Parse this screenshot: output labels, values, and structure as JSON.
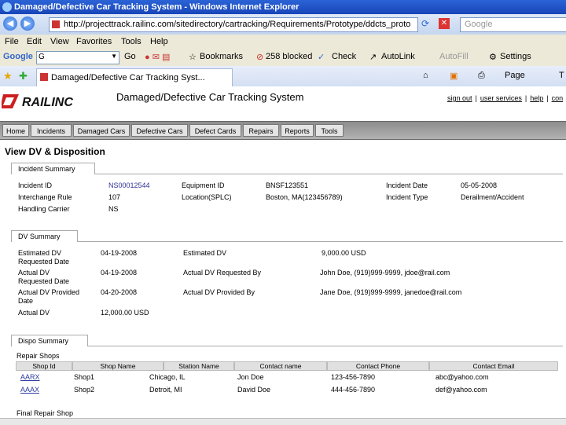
{
  "browser": {
    "window_title": "Damaged/Defective Car Tracking System - Windows Internet Explorer",
    "url": "http://projecttrack.railinc.com/sitedirectory/cartracking/Requirements/Prototype/ddcts_proto",
    "search_placeholder": "Google",
    "menu": [
      "File",
      "Edit",
      "View",
      "Favorites",
      "Tools",
      "Help"
    ],
    "google_toolbar": {
      "logo": "Google",
      "search_value": "G",
      "go_label": "Go",
      "bookmarks": "Bookmarks",
      "blocked": "258 blocked",
      "check": "Check",
      "autolink": "AutoLink",
      "autofill": "AutoFill",
      "settings": "Settings"
    },
    "tab_title": "Damaged/Defective Car Tracking Syst...",
    "page_menu": "Page",
    "tools_short": "T"
  },
  "app": {
    "logo_text": "RAILINC",
    "title": "Damaged/Defective Car Tracking System",
    "top_links": [
      "sign out",
      "user services",
      "help",
      "con"
    ],
    "nav": [
      "Home",
      "Incidents",
      "Damaged Cars",
      "Defective Cars",
      "Defect Cards",
      "Repairs",
      "Reports",
      "Tools"
    ]
  },
  "page": {
    "title": "View DV & Disposition",
    "incident_summary": {
      "tab_label": "Incident Summary",
      "incident_id_label": "Incident ID",
      "incident_id": "NS00012544",
      "equipment_id_label": "Equipment ID",
      "equipment_id": "BNSF123551",
      "incident_date_label": "Incident Date",
      "incident_date": "05-05-2008",
      "interchange_rule_label": "Interchange Rule",
      "interchange_rule": "107",
      "location_label": "Location(SPLC)",
      "location": "Boston, MA(123456789)",
      "incident_type_label": "Incident Type",
      "incident_type": "Derailment/Accident",
      "handling_carrier_label": "Handling Carrier",
      "handling_carrier": "NS"
    },
    "dv_summary": {
      "tab_label": "DV Summary",
      "est_dv_req_date_label_1": "Estimated DV",
      "est_dv_req_date_label_2": "Requested Date",
      "est_dv_req_date": "04-19-2008",
      "estimated_dv_label": "Estimated DV",
      "estimated_dv": "9,000.00 USD",
      "actual_dv_req_date_label_1": "Actual DV",
      "actual_dv_req_date_label_2": "Requested Date",
      "actual_dv_req_date": "04-19-2008",
      "actual_dv_requested_by_label": "Actual DV Requested By",
      "actual_dv_requested_by": "John Doe, (919)999-9999, jdoe@rail.com",
      "actual_dv_prov_date_label_1": "Actual DV Provided",
      "actual_dv_prov_date_label_2": "Date",
      "actual_dv_prov_date": "04-20-2008",
      "actual_dv_provided_by_label": "Actual DV Provided By",
      "actual_dv_provided_by": "Jane Doe, (919)999-9999, janedoe@rail.com",
      "actual_dv_label": "Actual DV",
      "actual_dv": "12,000.00 USD"
    },
    "dispo_summary": {
      "tab_label": "Dispo Summary",
      "repair_shops_label": "Repair Shops",
      "columns": [
        "Shop Id",
        "Shop Name",
        "Station Name",
        "Contact name",
        "Contact Phone",
        "Contact Email"
      ],
      "rows": [
        {
          "shop_id": "AARX",
          "shop_name": "Shop1",
          "station": "Chicago, IL",
          "contact": "Jon Doe",
          "phone": "123-456-7890",
          "email": "abc@yahoo.com"
        },
        {
          "shop_id": "AAAX",
          "shop_name": "Shop2",
          "station": "Detroit, MI",
          "contact": "David Doe",
          "phone": "444-456-7890",
          "email": "def@yahoo.com"
        }
      ],
      "final_repair_shop_label": "Final Repair Shop"
    }
  }
}
